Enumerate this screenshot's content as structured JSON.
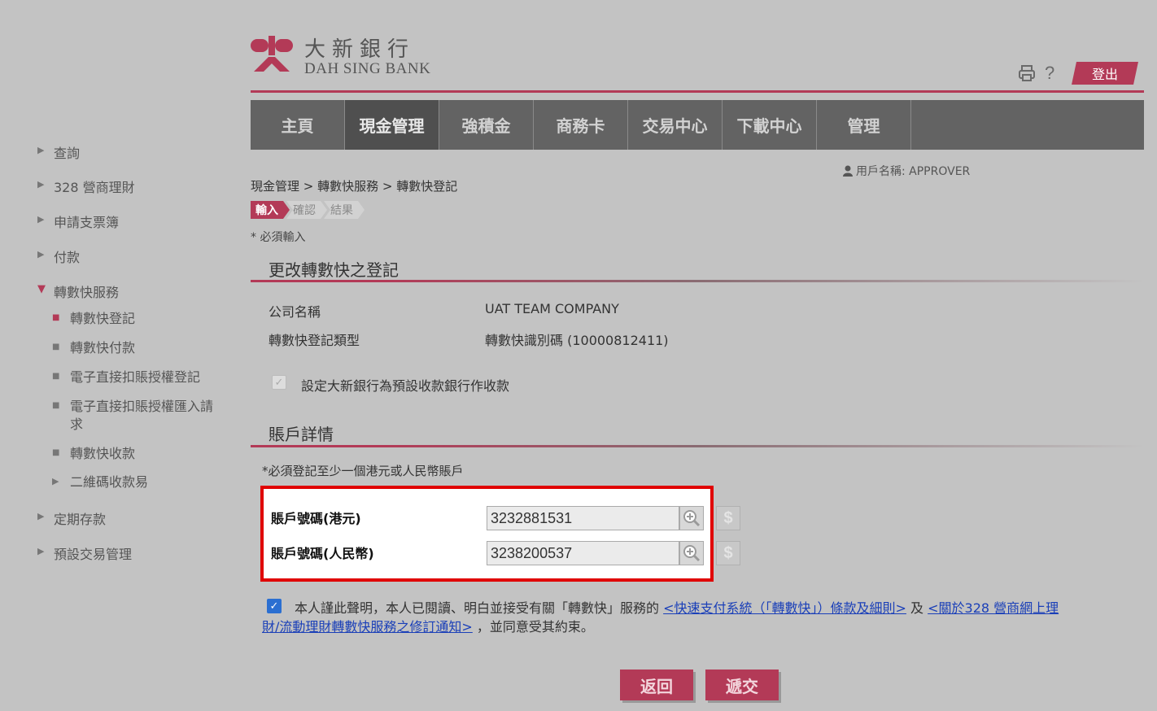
{
  "brand": {
    "name_cn": "大新銀行",
    "name_en": "DAH SING BANK",
    "accent": "#b33a57"
  },
  "toolbar": {
    "print_icon": "print-icon",
    "help_label": "?",
    "logout_label": "登出"
  },
  "nav": {
    "items": [
      {
        "label": "主頁",
        "active": false
      },
      {
        "label": "現金管理",
        "active": true
      },
      {
        "label": "強積金",
        "active": false
      },
      {
        "label": "商務卡",
        "active": false
      },
      {
        "label": "交易中心",
        "active": false
      },
      {
        "label": "下載中心",
        "active": false
      },
      {
        "label": "管理",
        "active": false
      }
    ]
  },
  "user": {
    "label": "用戶名稱: APPROVER"
  },
  "sidebar": {
    "items": [
      {
        "label": "查詢"
      },
      {
        "label": "328 營商理財"
      },
      {
        "label": "申請支票簿"
      },
      {
        "label": "付款"
      },
      {
        "label": "轉數快服務"
      },
      {
        "label": "定期存款"
      },
      {
        "label": "預設交易管理"
      }
    ],
    "sub_items": [
      {
        "label": "轉數快登記",
        "active": true
      },
      {
        "label": "轉數快付款"
      },
      {
        "label": "電子直接扣賬授權登記"
      },
      {
        "label": "電子直接扣賬授權匯入請求"
      },
      {
        "label": "轉數快收款"
      },
      {
        "label": "二維碼收款易"
      }
    ]
  },
  "main": {
    "breadcrumb": "現金管理 > 轉數快服務 > 轉數快登記",
    "steps": [
      "輸入",
      "確認",
      "結果"
    ],
    "required_note": "* 必須輸入",
    "section1_title": "更改轉數快之登記",
    "company_label": "公司名稱",
    "company_value": "UAT TEAM COMPANY",
    "type_label": "轉數快登記類型",
    "type_value": "轉數快識別碼 (10000812411)",
    "default_bank_label": "設定大新銀行為預設收款銀行作收款",
    "section2_title": "賬戶詳情",
    "account_note": "*必須登記至少一個港元或人民幣賬戶",
    "hkd_label": "賬戶號碼(港元)",
    "hkd_value": "3232881531",
    "rmb_label": "賬戶號碼(人民幣)",
    "rmb_value": "3238200537",
    "agree_prefix": "本人謹此聲明，本人已閱讀、明白並接受有關「轉數快」服務的",
    "agree_link1": "<快速支付系統（「轉數快」）條款及細則>",
    "agree_mid": " 及 ",
    "agree_link2": "<關於328 營商網上理財/流動理財轉數快服務之修訂通知>",
    "agree_suffix": "，並同意受其約束。"
  },
  "buttons": {
    "back_label": "返回",
    "submit_label": "遞交"
  }
}
